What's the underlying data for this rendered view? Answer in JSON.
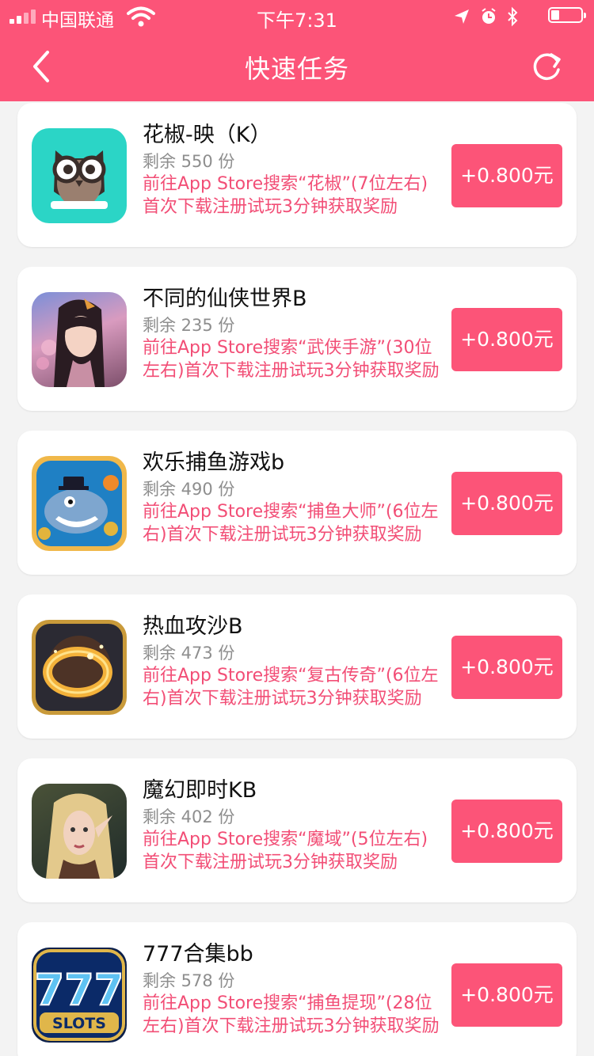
{
  "status_bar": {
    "carrier": "中国联通",
    "time": "下午7:31",
    "icons": [
      "signal-icon",
      "wifi-icon",
      "location-icon",
      "alarm-icon",
      "bluetooth-icon",
      "battery-icon"
    ]
  },
  "header": {
    "title": "快速任务",
    "back_icon": "chevron-left-icon",
    "refresh_icon": "refresh-icon"
  },
  "colors": {
    "accent": "#fc5478",
    "description_text": "#f24e76",
    "background": "#f3f3f3"
  },
  "tasks": [
    {
      "name": "花椒-映（K）",
      "remaining": "剩余 550 份",
      "description": "前往App Store搜索“花椒”(7位左右)首次下载注册试玩3分钟获取奖励",
      "reward": "+0.800元",
      "icon": "owl-app-icon"
    },
    {
      "name": "不同的仙侠世界B",
      "remaining": "剩余 235 份",
      "description": "前往App Store搜索“武侠手游”(30位左右)首次下载注册试玩3分钟获取奖励",
      "reward": "+0.800元",
      "icon": "xianxia-app-icon"
    },
    {
      "name": "欢乐捕鱼游戏b",
      "remaining": "剩余 490 份",
      "description": "前往App Store搜索“捕鱼大师”(6位左右)首次下载注册试玩3分钟获取奖励",
      "reward": "+0.800元",
      "icon": "shark-app-icon"
    },
    {
      "name": "热血攻沙B",
      "remaining": "剩余 473 份",
      "description": "前往App Store搜索“复古传奇”(6位左右)首次下载注册试玩3分钟获取奖励",
      "reward": "+0.800元",
      "icon": "ring-app-icon"
    },
    {
      "name": "魔幻即时KB",
      "remaining": "剩余 402 份",
      "description": "前往App Store搜索“魔域”(5位左右)首次下载注册试玩3分钟获取奖励",
      "reward": "+0.800元",
      "icon": "elf-app-icon"
    },
    {
      "name": "777合集bb",
      "remaining": "剩余 578 份",
      "description": "前往App Store搜索“捕鱼提现”(28位左右)首次下载注册试玩3分钟获取奖励",
      "reward": "+0.800元",
      "icon": "slots-app-icon",
      "icon_text": "SLOTS"
    }
  ]
}
